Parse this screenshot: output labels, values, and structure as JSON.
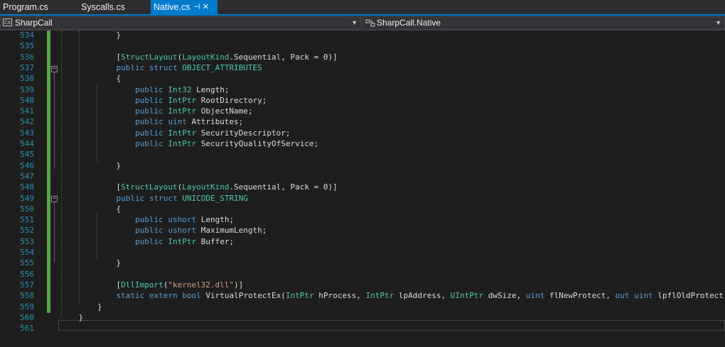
{
  "tabs": [
    {
      "label": "Program.cs",
      "active": false
    },
    {
      "label": "Syscalls.cs",
      "active": false
    },
    {
      "label": "Native.cs",
      "active": true,
      "icons": "⊣ ✕"
    }
  ],
  "navbar": {
    "project_icon_text": "C#",
    "project": "SharpCall",
    "type_icon": "class-icon",
    "type": "SharpCall.Native"
  },
  "colors": {
    "accent": "#007acc",
    "keyword": "#569cd6",
    "type": "#4ec9b0",
    "string": "#d69d85",
    "line_number": "#2b91af",
    "change_bar": "#57a64a"
  },
  "lines": [
    {
      "n": "534",
      "segs": [
        [
          "pl",
          "            }"
        ]
      ]
    },
    {
      "n": "535",
      "segs": []
    },
    {
      "n": "536",
      "segs": [
        [
          "pl",
          "            ["
        ],
        [
          "ty",
          "StructLayout"
        ],
        [
          "pl",
          "("
        ],
        [
          "ty",
          "LayoutKind"
        ],
        [
          "pl",
          ".Sequential, Pack = 0)]"
        ]
      ]
    },
    {
      "n": "537",
      "segs": [
        [
          "kw",
          "            public"
        ],
        [
          "pl",
          " "
        ],
        [
          "kw",
          "struct"
        ],
        [
          "pl",
          " "
        ],
        [
          "ty",
          "OBJECT_ATTRIBUTES"
        ]
      ]
    },
    {
      "n": "538",
      "segs": [
        [
          "pl",
          "            {"
        ]
      ]
    },
    {
      "n": "539",
      "segs": [
        [
          "kw",
          "                public"
        ],
        [
          "pl",
          " "
        ],
        [
          "ty",
          "Int32"
        ],
        [
          "pl",
          " Length;"
        ]
      ]
    },
    {
      "n": "540",
      "segs": [
        [
          "kw",
          "                public"
        ],
        [
          "pl",
          " "
        ],
        [
          "ty",
          "IntPtr"
        ],
        [
          "pl",
          " RootDirectory;"
        ]
      ]
    },
    {
      "n": "541",
      "segs": [
        [
          "kw",
          "                public"
        ],
        [
          "pl",
          " "
        ],
        [
          "ty",
          "IntPtr"
        ],
        [
          "pl",
          " ObjectName;"
        ]
      ]
    },
    {
      "n": "542",
      "segs": [
        [
          "kw",
          "                public"
        ],
        [
          "pl",
          " "
        ],
        [
          "kw",
          "uint"
        ],
        [
          "pl",
          " Attributes;"
        ]
      ]
    },
    {
      "n": "543",
      "segs": [
        [
          "kw",
          "                public"
        ],
        [
          "pl",
          " "
        ],
        [
          "ty",
          "IntPtr"
        ],
        [
          "pl",
          " SecurityDescriptor;"
        ]
      ]
    },
    {
      "n": "544",
      "segs": [
        [
          "kw",
          "                public"
        ],
        [
          "pl",
          " "
        ],
        [
          "ty",
          "IntPtr"
        ],
        [
          "pl",
          " SecurityQualityOfService;"
        ]
      ]
    },
    {
      "n": "545",
      "segs": []
    },
    {
      "n": "546",
      "segs": [
        [
          "pl",
          "            }"
        ]
      ]
    },
    {
      "n": "547",
      "segs": []
    },
    {
      "n": "548",
      "segs": [
        [
          "pl",
          "            ["
        ],
        [
          "ty",
          "StructLayout"
        ],
        [
          "pl",
          "("
        ],
        [
          "ty",
          "LayoutKind"
        ],
        [
          "pl",
          ".Sequential, Pack = 0)]"
        ]
      ]
    },
    {
      "n": "549",
      "segs": [
        [
          "kw",
          "            public"
        ],
        [
          "pl",
          " "
        ],
        [
          "kw",
          "struct"
        ],
        [
          "pl",
          " "
        ],
        [
          "ty",
          "UNICODE_STRING"
        ]
      ]
    },
    {
      "n": "550",
      "segs": [
        [
          "pl",
          "            {"
        ]
      ]
    },
    {
      "n": "551",
      "segs": [
        [
          "kw",
          "                public"
        ],
        [
          "pl",
          " "
        ],
        [
          "kw",
          "ushort"
        ],
        [
          "pl",
          " Length;"
        ]
      ]
    },
    {
      "n": "552",
      "segs": [
        [
          "kw",
          "                public"
        ],
        [
          "pl",
          " "
        ],
        [
          "kw",
          "ushort"
        ],
        [
          "pl",
          " MaximumLength;"
        ]
      ]
    },
    {
      "n": "553",
      "segs": [
        [
          "kw",
          "                public"
        ],
        [
          "pl",
          " "
        ],
        [
          "ty",
          "IntPtr"
        ],
        [
          "pl",
          " Buffer;"
        ]
      ]
    },
    {
      "n": "554",
      "segs": []
    },
    {
      "n": "555",
      "segs": [
        [
          "pl",
          "            }"
        ]
      ]
    },
    {
      "n": "556",
      "segs": []
    },
    {
      "n": "557",
      "segs": [
        [
          "pl",
          "            ["
        ],
        [
          "ty",
          "DllImport"
        ],
        [
          "pl",
          "("
        ],
        [
          "str",
          "\"kernel32.dll\""
        ],
        [
          "pl",
          ")]"
        ]
      ]
    },
    {
      "n": "558",
      "segs": [
        [
          "kw",
          "            static"
        ],
        [
          "pl",
          " "
        ],
        [
          "kw",
          "extern"
        ],
        [
          "pl",
          " "
        ],
        [
          "kw",
          "bool"
        ],
        [
          "pl",
          " VirtualProtectEx("
        ],
        [
          "ty",
          "IntPtr"
        ],
        [
          "pl",
          " hProcess, "
        ],
        [
          "ty",
          "IntPtr"
        ],
        [
          "pl",
          " lpAddress, "
        ],
        [
          "ty",
          "UIntPtr"
        ],
        [
          "pl",
          " dwSize, "
        ],
        [
          "kw",
          "uint"
        ],
        [
          "pl",
          " flNewProtect, "
        ],
        [
          "kw",
          "out"
        ],
        [
          "pl",
          " "
        ],
        [
          "kw",
          "uint"
        ],
        [
          "pl",
          " lpflOldProtect);"
        ]
      ]
    },
    {
      "n": "559",
      "segs": [
        [
          "pl",
          "        }"
        ]
      ]
    },
    {
      "n": "560",
      "segs": [
        [
          "pl",
          "    }"
        ]
      ]
    },
    {
      "n": "561",
      "segs": []
    }
  ]
}
